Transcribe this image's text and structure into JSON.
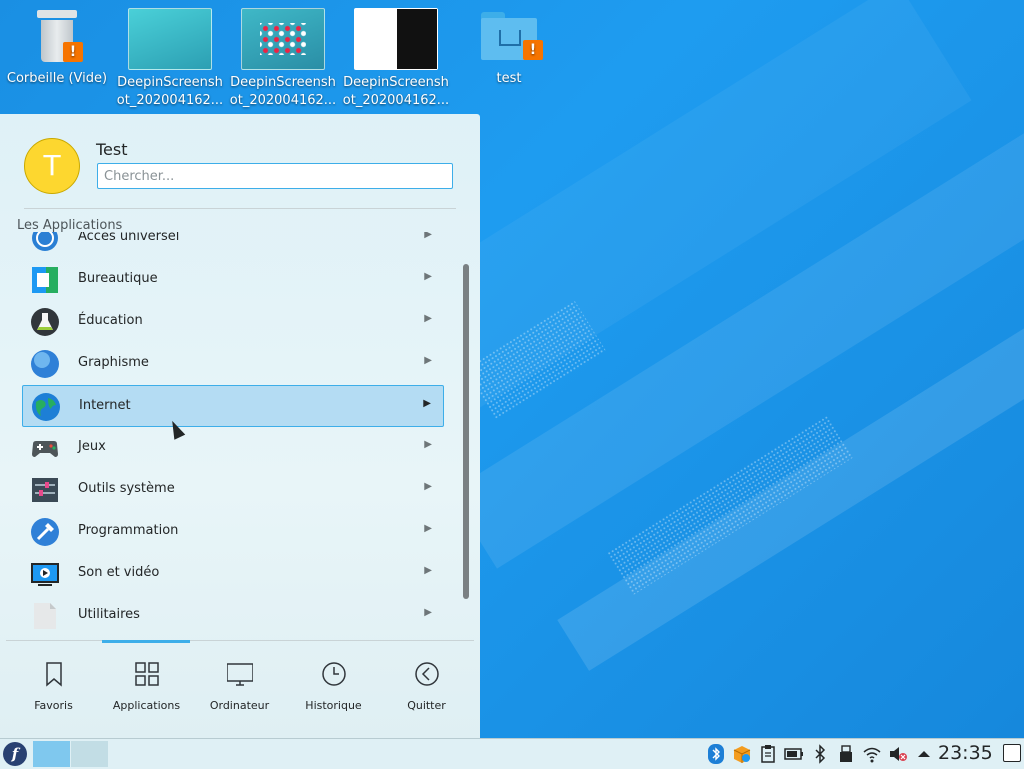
{
  "desktop": {
    "icons": [
      {
        "label": "Corbeille (Vide)",
        "icon": "trash-icon",
        "badge": "!"
      },
      {
        "label": "DeepinScreenshot_202004162...",
        "icon": "screenshot-thumbnail"
      },
      {
        "label": "DeepinScreenshot_202004162...",
        "icon": "screenshot-thumbnail"
      },
      {
        "label": "DeepinScreenshot_202004162...",
        "icon": "screenshot-thumbnail"
      },
      {
        "label": "test",
        "icon": "home-folder-icon",
        "badge": "!"
      }
    ]
  },
  "launcher": {
    "user": {
      "initial": "T",
      "name": "Test"
    },
    "search": {
      "placeholder": "Chercher...",
      "value": ""
    },
    "section_title": "Les Applications",
    "apps": [
      {
        "label": "Accès universel",
        "icon": "accessibility-icon"
      },
      {
        "label": "Bureautique",
        "icon": "office-icon"
      },
      {
        "label": "Éducation",
        "icon": "education-flask-icon"
      },
      {
        "label": "Graphisme",
        "icon": "graphics-icon"
      },
      {
        "label": "Internet",
        "icon": "globe-icon",
        "highlighted": true
      },
      {
        "label": "Jeux",
        "icon": "gamepad-icon"
      },
      {
        "label": "Outils système",
        "icon": "system-tools-icon"
      },
      {
        "label": "Programmation",
        "icon": "programming-icon"
      },
      {
        "label": "Son et vidéo",
        "icon": "multimedia-icon"
      },
      {
        "label": "Utilitaires",
        "icon": "utilities-icon"
      }
    ],
    "tabs": [
      {
        "label": "Favoris",
        "icon": "bookmark-icon"
      },
      {
        "label": "Applications",
        "icon": "grid-icon",
        "active": true
      },
      {
        "label": "Ordinateur",
        "icon": "monitor-icon"
      },
      {
        "label": "Historique",
        "icon": "clock-icon"
      },
      {
        "label": "Quitter",
        "icon": "back-arrow-icon"
      }
    ]
  },
  "taskbar": {
    "launcher_icon": "fedora-icon",
    "launcher_glyph": "f",
    "tray_icons": [
      "bluetooth-app-icon",
      "package-updater-icon",
      "clipboard-icon",
      "battery-icon",
      "bluetooth-icon",
      "usb-device-icon",
      "wifi-icon",
      "volume-muted-icon",
      "expand-tray-icon"
    ],
    "clock": "23:35"
  },
  "colors": {
    "accent": "#3daee9",
    "highlight_bg": "#b4dcf3",
    "badge": "#f67400",
    "avatar": "#fdd72f"
  }
}
